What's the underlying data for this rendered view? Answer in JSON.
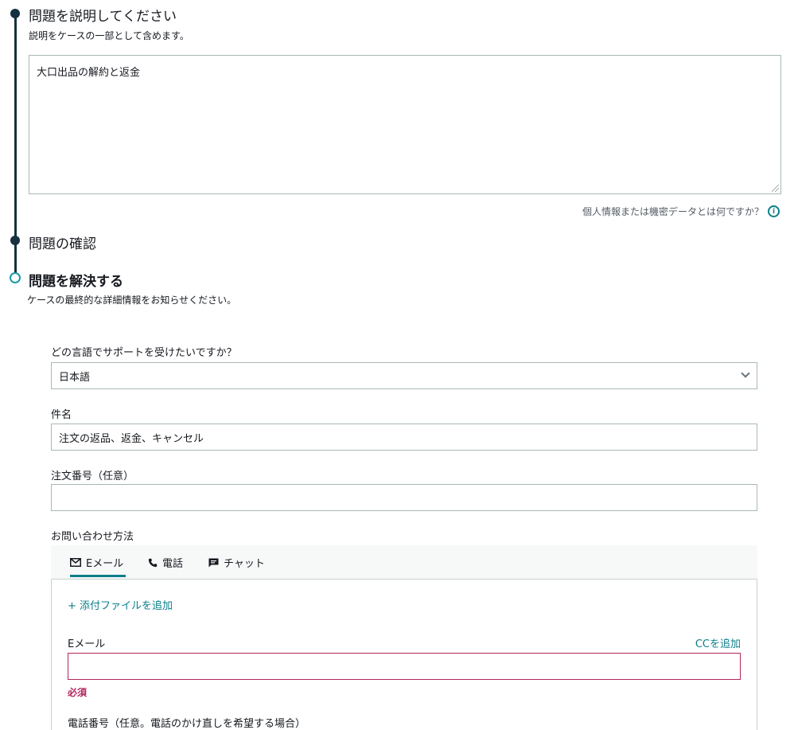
{
  "step1": {
    "title": "問題を説明してください",
    "subtitle": "説明をケースの一部として含めます。",
    "description_value": "大口出品の解約と返金",
    "pii_link": "個人情報または機密データとは何ですか？"
  },
  "step2": {
    "title": "問題の確認"
  },
  "step3": {
    "title": "問題を解決する",
    "subtitle": "ケースの最終的な詳細情報をお知らせください。"
  },
  "form": {
    "language_label": "どの言語でサポートを受けたいですか？",
    "language_value": "日本語",
    "subject_label": "件名",
    "subject_value": "注文の返品、返金、キャンセル",
    "order_label": "注文番号（任意）",
    "order_value": "",
    "contact_label": "お問い合わせ方法"
  },
  "tabs": [
    {
      "label": "Eメール",
      "icon": "mail-icon"
    },
    {
      "label": "電話",
      "icon": "phone-icon"
    },
    {
      "label": "チャット",
      "icon": "chat-icon"
    }
  ],
  "email_panel": {
    "attach_link": "+ 添付ファイルを追加",
    "email_label": "Eメール",
    "cc_link": "CCを追加",
    "email_value": "",
    "error": "必須",
    "phone_label": "電話番号（任意。電話のかけ直しを希望する場合）"
  },
  "colors": {
    "timeline": "#16313f",
    "accent": "#0b7f8a",
    "error": "#b3265e"
  }
}
